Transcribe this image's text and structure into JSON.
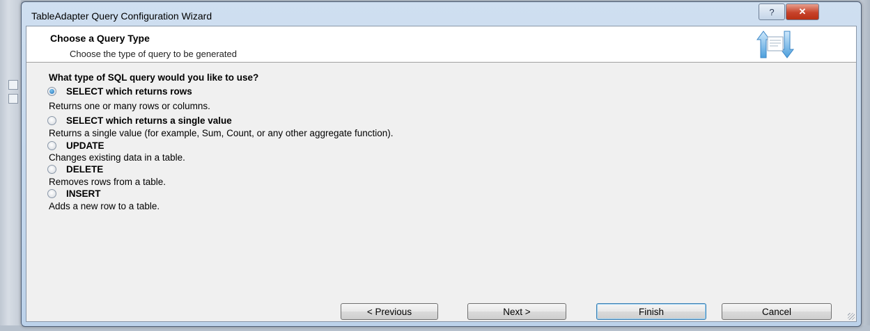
{
  "window": {
    "title": "TableAdapter Query Configuration Wizard"
  },
  "titlebar": {
    "help_glyph": "?",
    "close_glyph": "✕"
  },
  "header": {
    "title": "Choose a Query Type",
    "subtitle": "Choose the type of query to be generated",
    "icon": "query-wizard-icon"
  },
  "question": "What type of SQL query would you like to use?",
  "options": [
    {
      "label": "SELECT which returns rows",
      "description": "Returns one or many rows or columns.",
      "selected": true
    },
    {
      "label": "SELECT which returns a single value",
      "description": "Returns a single value (for example, Sum, Count, or any other aggregate function).",
      "selected": false
    },
    {
      "label": "UPDATE",
      "description": "Changes existing data in a table.",
      "selected": false
    },
    {
      "label": "DELETE",
      "description": "Removes rows from a table.",
      "selected": false
    },
    {
      "label": "INSERT",
      "description": "Adds a new row to a table.",
      "selected": false
    }
  ],
  "buttons": {
    "previous": "< Previous",
    "next": "Next >",
    "finish": "Finish",
    "cancel": "Cancel"
  },
  "colors": {
    "accent": "#1f6fb8",
    "close": "#c7432b",
    "frame": "#bcd2ea"
  }
}
